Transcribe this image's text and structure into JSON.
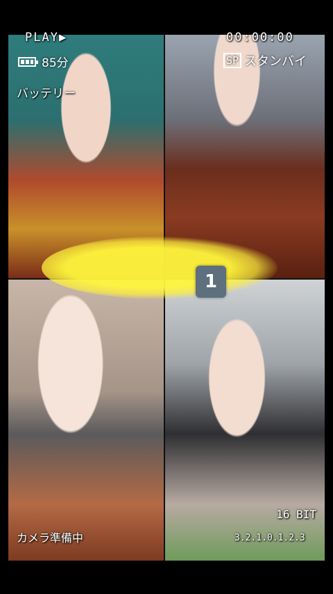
{
  "hud": {
    "play_label": "PLAY▶",
    "timecode": "00:00:00",
    "battery_text": "85分",
    "battery_label": "バッテリー",
    "sp_label": "SP",
    "standby_text": "スタンバイ",
    "badge_number": "1",
    "bit_label": "16 BIT",
    "camera_status": "カメラ準備中",
    "level_scale": "3.2.1.0.1.2.3"
  },
  "colors": {
    "hud_text": "#ffffff",
    "badge_bg": "#5e6f7e",
    "highlight": "#fff03c",
    "background": "#000000"
  },
  "icons": {
    "battery": "battery-icon"
  }
}
